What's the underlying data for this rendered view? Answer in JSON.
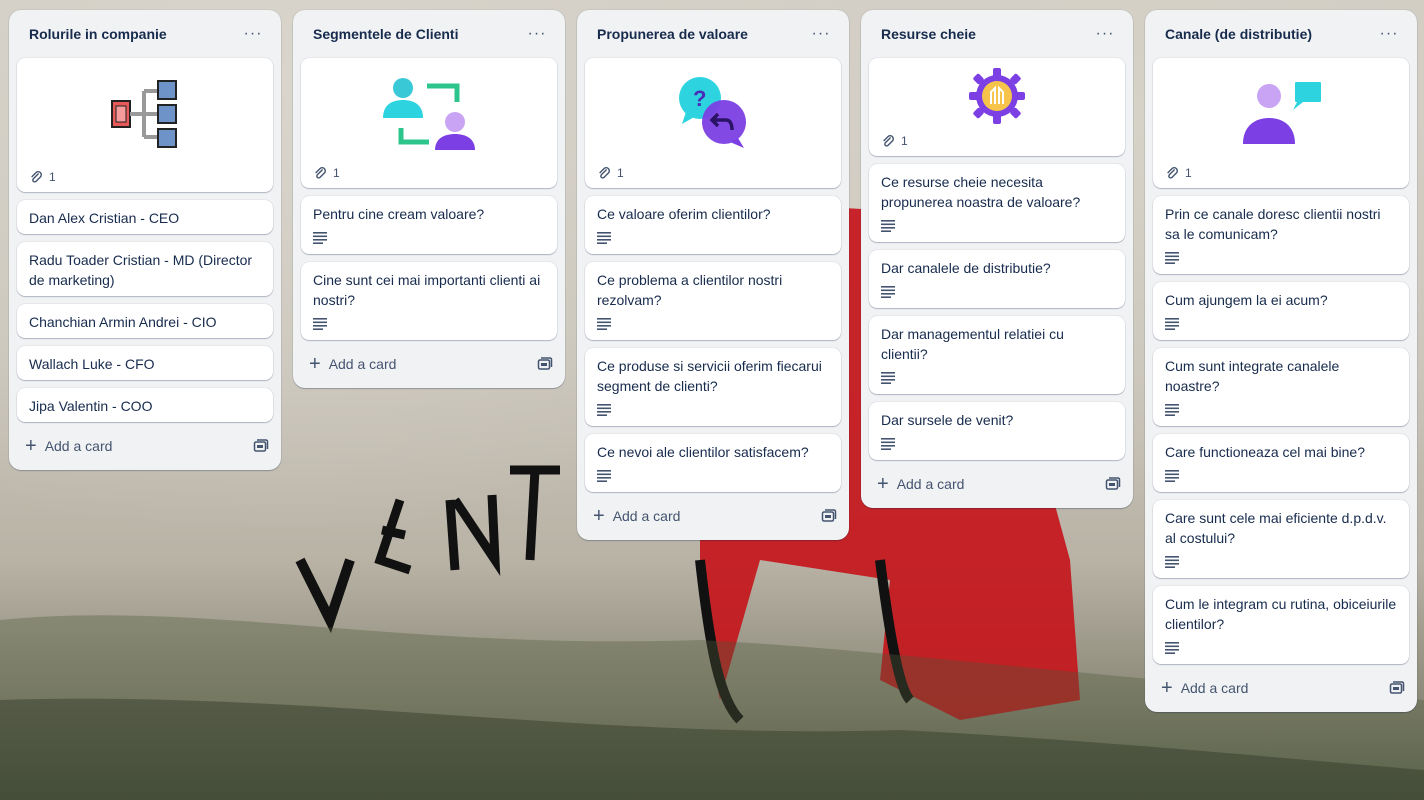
{
  "lists": [
    {
      "title": "Rolurile in companie",
      "menu": "···",
      "cover": {
        "icon": "org-chart-icon",
        "attachments": "1"
      },
      "cards": [
        {
          "text": "Dan Alex Cristian - CEO"
        },
        {
          "text": "Radu Toader Cristian - MD (Director de marketing)"
        },
        {
          "text": "Chanchian Armin Andrei - CIO"
        },
        {
          "text": "Wallach Luke - CFO"
        },
        {
          "text": "Jipa Valentin - COO"
        }
      ],
      "add_label": "Add a card"
    },
    {
      "title": "Segmentele de Clienti",
      "menu": "···",
      "cover": {
        "icon": "customer-segments-icon",
        "attachments": "1"
      },
      "cards": [
        {
          "text": "Pentru cine cream valoare?"
        },
        {
          "text": "Cine sunt cei mai importanti clienti ai nostri?"
        }
      ],
      "add_label": "Add a card"
    },
    {
      "title": "Propunerea de valoare",
      "menu": "···",
      "cover": {
        "icon": "chat-bubbles-icon",
        "attachments": "1"
      },
      "cards": [
        {
          "text": "Ce valoare oferim clientilor?"
        },
        {
          "text": "Ce problema a clientilor nostri rezolvam?"
        },
        {
          "text": "Ce produse si servicii oferim fiecarui segment de clienti?"
        },
        {
          "text": "Ce nevoi ale clientilor satisfacem?"
        }
      ],
      "add_label": "Add a card"
    },
    {
      "title": "Resurse cheie",
      "menu": "···",
      "cover": {
        "icon": "resources-gear-icon",
        "attachments": "1"
      },
      "cards": [
        {
          "text": "Ce resurse cheie necesita propunerea noastra de valoare?"
        },
        {
          "text": "Dar canalele de distributie?"
        },
        {
          "text": "Dar managementul relatiei cu clientii?"
        },
        {
          "text": "Dar sursele de venit?"
        }
      ],
      "add_label": "Add a card"
    },
    {
      "title": "Canale (de distributie)",
      "menu": "···",
      "cover": {
        "icon": "person-speech-icon",
        "attachments": "1"
      },
      "cards": [
        {
          "text": "Prin ce canale doresc clientii nostri sa le comunicam?"
        },
        {
          "text": "Cum ajungem la ei acum?"
        },
        {
          "text": "Cum sunt integrate canalele noastre?"
        },
        {
          "text": "Care functioneaza cel mai bine?"
        },
        {
          "text": "Care sunt cele mai eficiente d.p.d.v. al costului?"
        },
        {
          "text": "Cum le integram cu rutina, obiceiurile clientilor?"
        }
      ],
      "add_label": "Add a card"
    }
  ],
  "colors": {
    "list_bg": "#f1f2f4",
    "card_bg": "#ffffff",
    "text": "#172b4d",
    "subtle_text": "#44546f",
    "teal": "#2dd4e0",
    "purple": "#7b3fe4",
    "green": "#2ec58c"
  }
}
